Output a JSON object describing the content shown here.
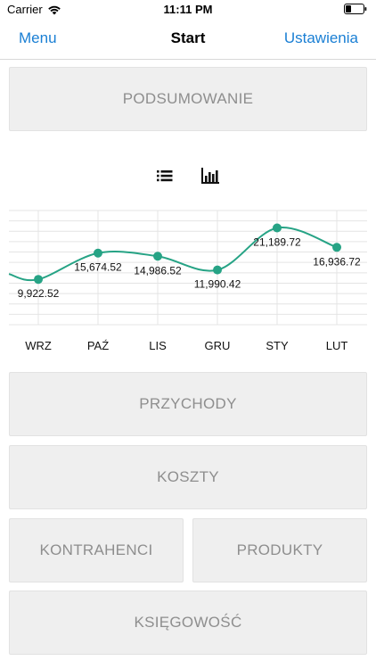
{
  "status_bar": {
    "carrier": "Carrier",
    "time": "11:11 PM"
  },
  "nav": {
    "left_label": "Menu",
    "title": "Start",
    "right_label": "Ustawienia",
    "accent_color": "#1a7fd4"
  },
  "tiles": {
    "summary": "PODSUMOWANIE",
    "income": "PRZYCHODY",
    "costs": "KOSZTY",
    "contractors": "KONTRAHENCI",
    "products": "PRODUKTY",
    "accounting": "KSIĘGOWOŚĆ"
  },
  "chart_toggles": {
    "list_icon": "list-icon",
    "bar_chart_icon": "bar-chart-icon"
  },
  "chart_data": {
    "type": "line",
    "categories": [
      "WRZ",
      "PAŹ",
      "LIS",
      "GRU",
      "STY",
      "LUT"
    ],
    "values": [
      9922.52,
      15674.52,
      14986.52,
      11990.42,
      21189.72,
      16936.72
    ],
    "value_labels": [
      "9,922.52",
      "15,674.52",
      "14,986.52",
      "11,990.42",
      "21,189.72",
      "16,936.72"
    ],
    "ylim": [
      0,
      25000
    ],
    "grid": true,
    "line_color": "#26a385"
  }
}
